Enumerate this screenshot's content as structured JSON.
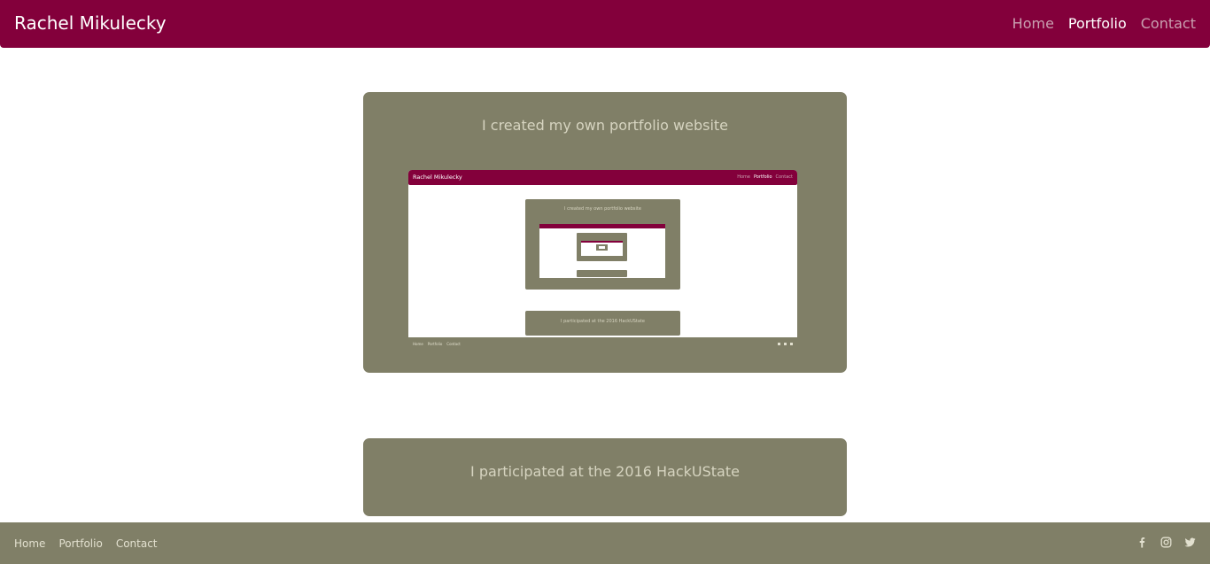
{
  "site": {
    "brand": "Rachel Mikulecky"
  },
  "nav": {
    "home": "Home",
    "portfolio": "Portfolio",
    "contact": "Contact"
  },
  "projects": [
    {
      "title": "I created my own portfolio website"
    },
    {
      "title": "I participated at the 2016 HackUState"
    }
  ],
  "footer": {
    "home": "Home",
    "portfolio": "Portfolio",
    "contact": "Contact"
  },
  "social_icons": [
    "facebook-icon",
    "instagram-icon",
    "twitter-icon"
  ],
  "colors": {
    "brand": "#83003b",
    "card": "#807f67",
    "footer": "#807f67"
  }
}
